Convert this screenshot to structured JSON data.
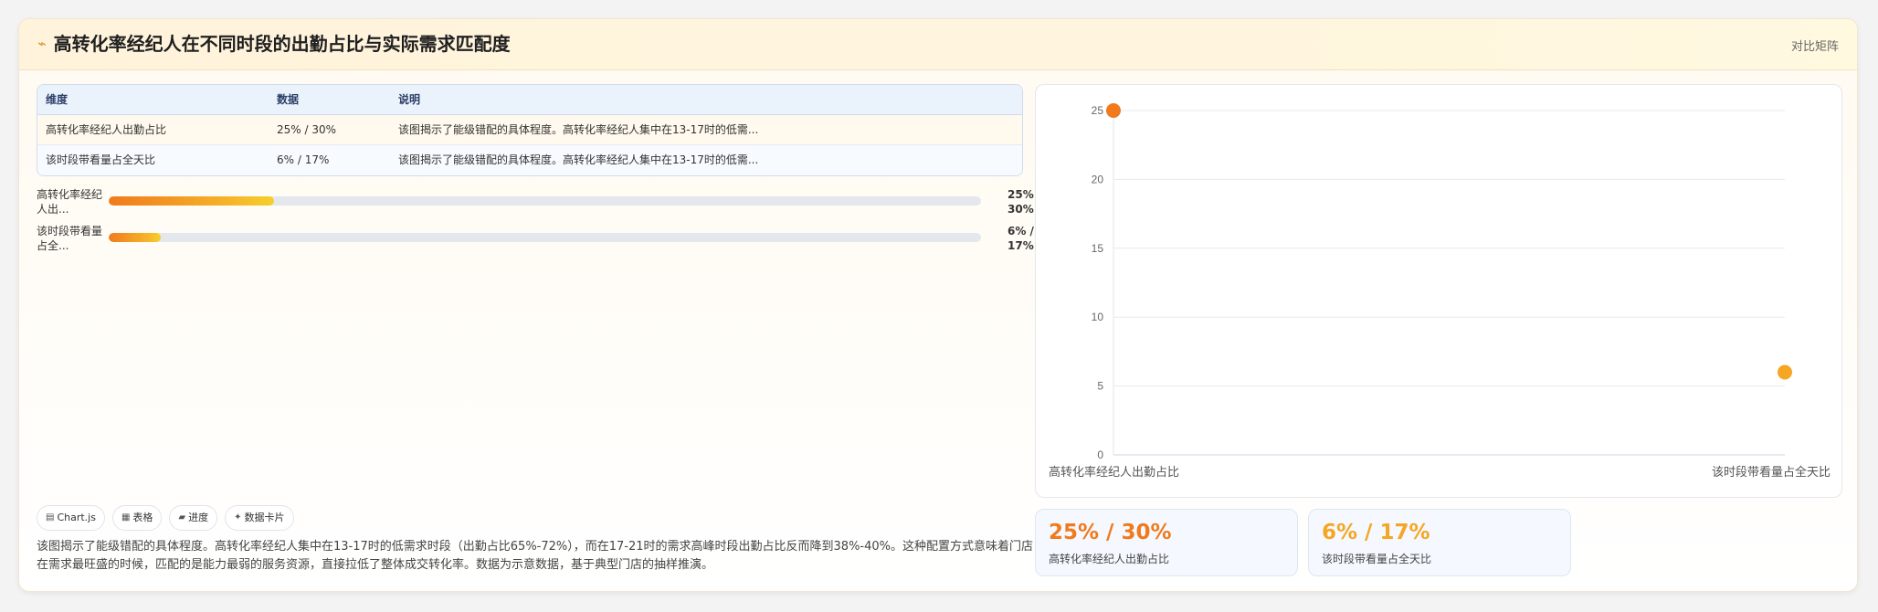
{
  "header": {
    "icon": "bolt-icon",
    "title": "高转化率经纪人在不同时段的出勤占比与实际需求匹配度",
    "tag": "对比矩阵"
  },
  "table": {
    "headers": [
      "维度",
      "数据",
      "说明"
    ],
    "rows": [
      [
        "高转化率经纪人出勤占比",
        "25% / 30%",
        "该图揭示了能级错配的具体程度。高转化率经纪人集中在13-17时的低需..."
      ],
      [
        "该时段带看量占全天比",
        "6% / 17%",
        "该图揭示了能级错配的具体程度。高转化率经纪人集中在13-17时的低需..."
      ]
    ]
  },
  "progress": [
    {
      "label": "高转化率经纪人出...",
      "value_text": "25% / 30%",
      "fraction": 0.19
    },
    {
      "label": "该时段带看量占全...",
      "value_text": "6% / 17%",
      "fraction": 0.06
    }
  ],
  "chips": [
    {
      "icon": "chart-icon",
      "glyph": "▤",
      "label": "Chart.js"
    },
    {
      "icon": "table-icon",
      "glyph": "▦",
      "label": "表格"
    },
    {
      "icon": "progress-icon",
      "glyph": "▰",
      "label": "进度"
    },
    {
      "icon": "sparkle-icon",
      "glyph": "✦",
      "label": "数据卡片"
    }
  ],
  "description": "该图揭示了能级错配的具体程度。高转化率经纪人集中在13-17时的低需求时段（出勤占比65%-72%），而在17-21时的需求高峰时段出勤占比反而降到38%-40%。这种配置方式意味着门店在需求最旺盛的时候，匹配的是能力最弱的服务资源，直接拉低了整体成交转化率。数据为示意数据，基于典型门店的抽样推演。",
  "chart_data": {
    "type": "scatter",
    "categories": [
      "高转化率经纪人出勤占比",
      "该时段带看量占全天比"
    ],
    "values": [
      25,
      6
    ],
    "point_colors": [
      "#f07a1c",
      "#f5a623"
    ],
    "ylim": [
      0,
      25
    ],
    "yticks": [
      "0",
      "5",
      "10",
      "15",
      "20",
      "25"
    ],
    "ytick_values": [
      0,
      5,
      10,
      15,
      20,
      25
    ],
    "grid": true
  },
  "stats": [
    {
      "value": "25% / 30%",
      "label": "高转化率经纪人出勤占比",
      "color": "#f07a1c"
    },
    {
      "value": "6% / 17%",
      "label": "该时段带看量占全天比",
      "color": "#f5a623"
    }
  ]
}
